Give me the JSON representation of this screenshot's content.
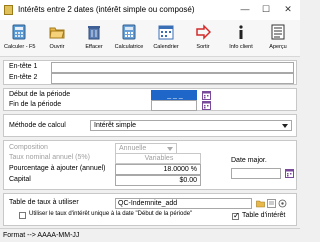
{
  "window": {
    "title": "Intérêts entre 2 dates (intérêt simple ou composé)",
    "minimize": "—",
    "maximize": "☐",
    "close": "✕"
  },
  "toolbar": {
    "items": [
      {
        "label": "Calculer - F5",
        "icon": "calculator-icon"
      },
      {
        "label": "Ouvrir",
        "icon": "folder-open-icon"
      },
      {
        "label": "Effacer",
        "icon": "trash-icon"
      },
      {
        "label": "Calculatrice",
        "icon": "calculator-icon"
      },
      {
        "label": "Calendrier",
        "icon": "calendar-icon"
      },
      {
        "label": "Sortir",
        "icon": "exit-arrow-icon"
      },
      {
        "label": "Info client",
        "icon": "info-icon"
      },
      {
        "label": "Aperçu",
        "icon": "preview-icon"
      }
    ]
  },
  "headers": {
    "header1_label": "En-tête 1",
    "header1_value": "",
    "header2_label": "En-tête 2",
    "header2_value": ""
  },
  "period": {
    "start_label": "Début de la période",
    "start_value": "_ _ _",
    "end_label": "Fin de la période",
    "end_value": ""
  },
  "method": {
    "label": "Méthode de calcul",
    "value": "Intérêt simple"
  },
  "params": {
    "composition_label": "Composition",
    "composition_value": "Annuelle",
    "nominal_label": "Taux nominal annuel (5%)",
    "nominal_value": "Variables",
    "percent_label": "Pourcentage à ajouter (annuel)",
    "percent_value": "18.0000 %",
    "capital_label": "Capital",
    "capital_value": "$0.00",
    "date_major_label": "Date major."
  },
  "rates": {
    "table_label": "Table de taux à utiliser",
    "table_value": "QC-Indemnite_add",
    "use_unique_label": "Utiliser le taux d'intérêt unique à la date \"Début de la période\"",
    "use_unique_checked": false,
    "table_interest_label": "Table d'intérêt",
    "table_interest_checked": true
  },
  "status": {
    "text": "Format --> AAAA-MM-JJ"
  },
  "colors": {
    "accent": "#0078d7",
    "date_highlight": "#1e66c8",
    "calendar_icon": "#7a4a9a"
  }
}
